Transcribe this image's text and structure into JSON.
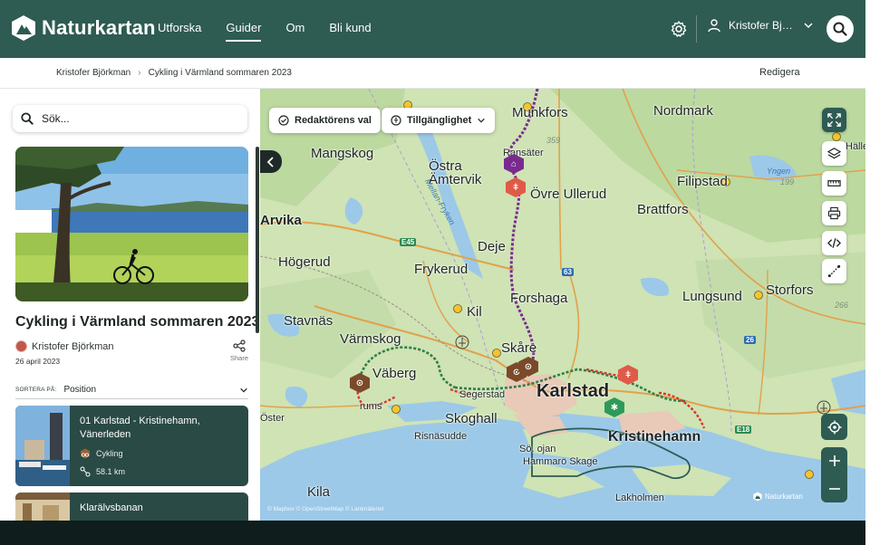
{
  "app": {
    "name": "Naturkartan",
    "brand_color": "#2e5b52"
  },
  "nav": {
    "items": [
      {
        "label": "Utforska",
        "active": false
      },
      {
        "label": "Guider",
        "active": true
      },
      {
        "label": "Om",
        "active": false
      },
      {
        "label": "Bli kund",
        "active": false
      }
    ],
    "user_name": "Kristofer Björkman"
  },
  "breadcrumb": {
    "items": [
      "Kristofer Björkman",
      "Cykling i Värmland sommaren 2023"
    ],
    "edit_label": "Redigera"
  },
  "sidebar": {
    "search_placeholder": "Sök...",
    "guide_title": "Cykling i Värmland sommaren 2023",
    "author": "Kristofer Björkman",
    "date": "26 april 2023",
    "share_label": "Share",
    "sort_label": "SORTERA PÅ:",
    "sort_value": "Position",
    "cards": [
      {
        "title": "01 Karlstad - Kristinehamn, Vänerleden",
        "category": "Cykling",
        "distance": "58.1 km"
      },
      {
        "title": "Klarälvsbanan"
      }
    ]
  },
  "map": {
    "filters": [
      "Redaktörens val",
      "Tillgänglighet"
    ],
    "places": {
      "karlstad": "Karlstad",
      "kristinehamn": "Kristinehamn",
      "skoghall": "Skoghall",
      "munkfors": "Munkfors",
      "nordmark": "Nordmark",
      "filipstad": "Filipstad",
      "brattfors": "Brattfors",
      "lungsund": "Lungsund",
      "storfors": "Storfors",
      "forshaga": "Forshaga",
      "deje": "Deje",
      "frykerud": "Frykerud",
      "hogerud": "Högerud",
      "mangskog": "Mangskog",
      "ostra_amtervik": "Östra\nÄmtervik",
      "ovre_ullerud": "Övre Ullerud",
      "ransater": "Ransäter",
      "skare": "Skåre",
      "kil": "Kil",
      "varmskog": "Värmskog",
      "stavnas": "Stavnäs",
      "vaberg": "Väberg",
      "segerstad": "Segerstad",
      "risnasudde": "Risnäsudde",
      "sodra_ojan": "Sö. ojan",
      "hammaro_skage": "Hammarö Skage",
      "lakholmen": "Lakholmen",
      "kila": "Kila",
      "arvika": "Arvika",
      "halle": "Hälle",
      "ungen": "Yngen",
      "mellan_fryken": "Mellan-Fryken",
      "rums": "rums",
      "oster": "Öster"
    },
    "elevations": [
      "359",
      "199",
      "266"
    ],
    "roads": [
      "E45",
      "63",
      "26",
      "E18"
    ],
    "attribution": "© Mapbox © OpenStreetMap © Lantmäteriet",
    "watermark": "Naturkartan",
    "colors": {
      "route_purple": "#7a2a8f",
      "route_green": "#2e7d4a",
      "route_red": "#d8372c",
      "poi_brown": "#7a4a2a",
      "poi_red": "#e05a48"
    }
  }
}
